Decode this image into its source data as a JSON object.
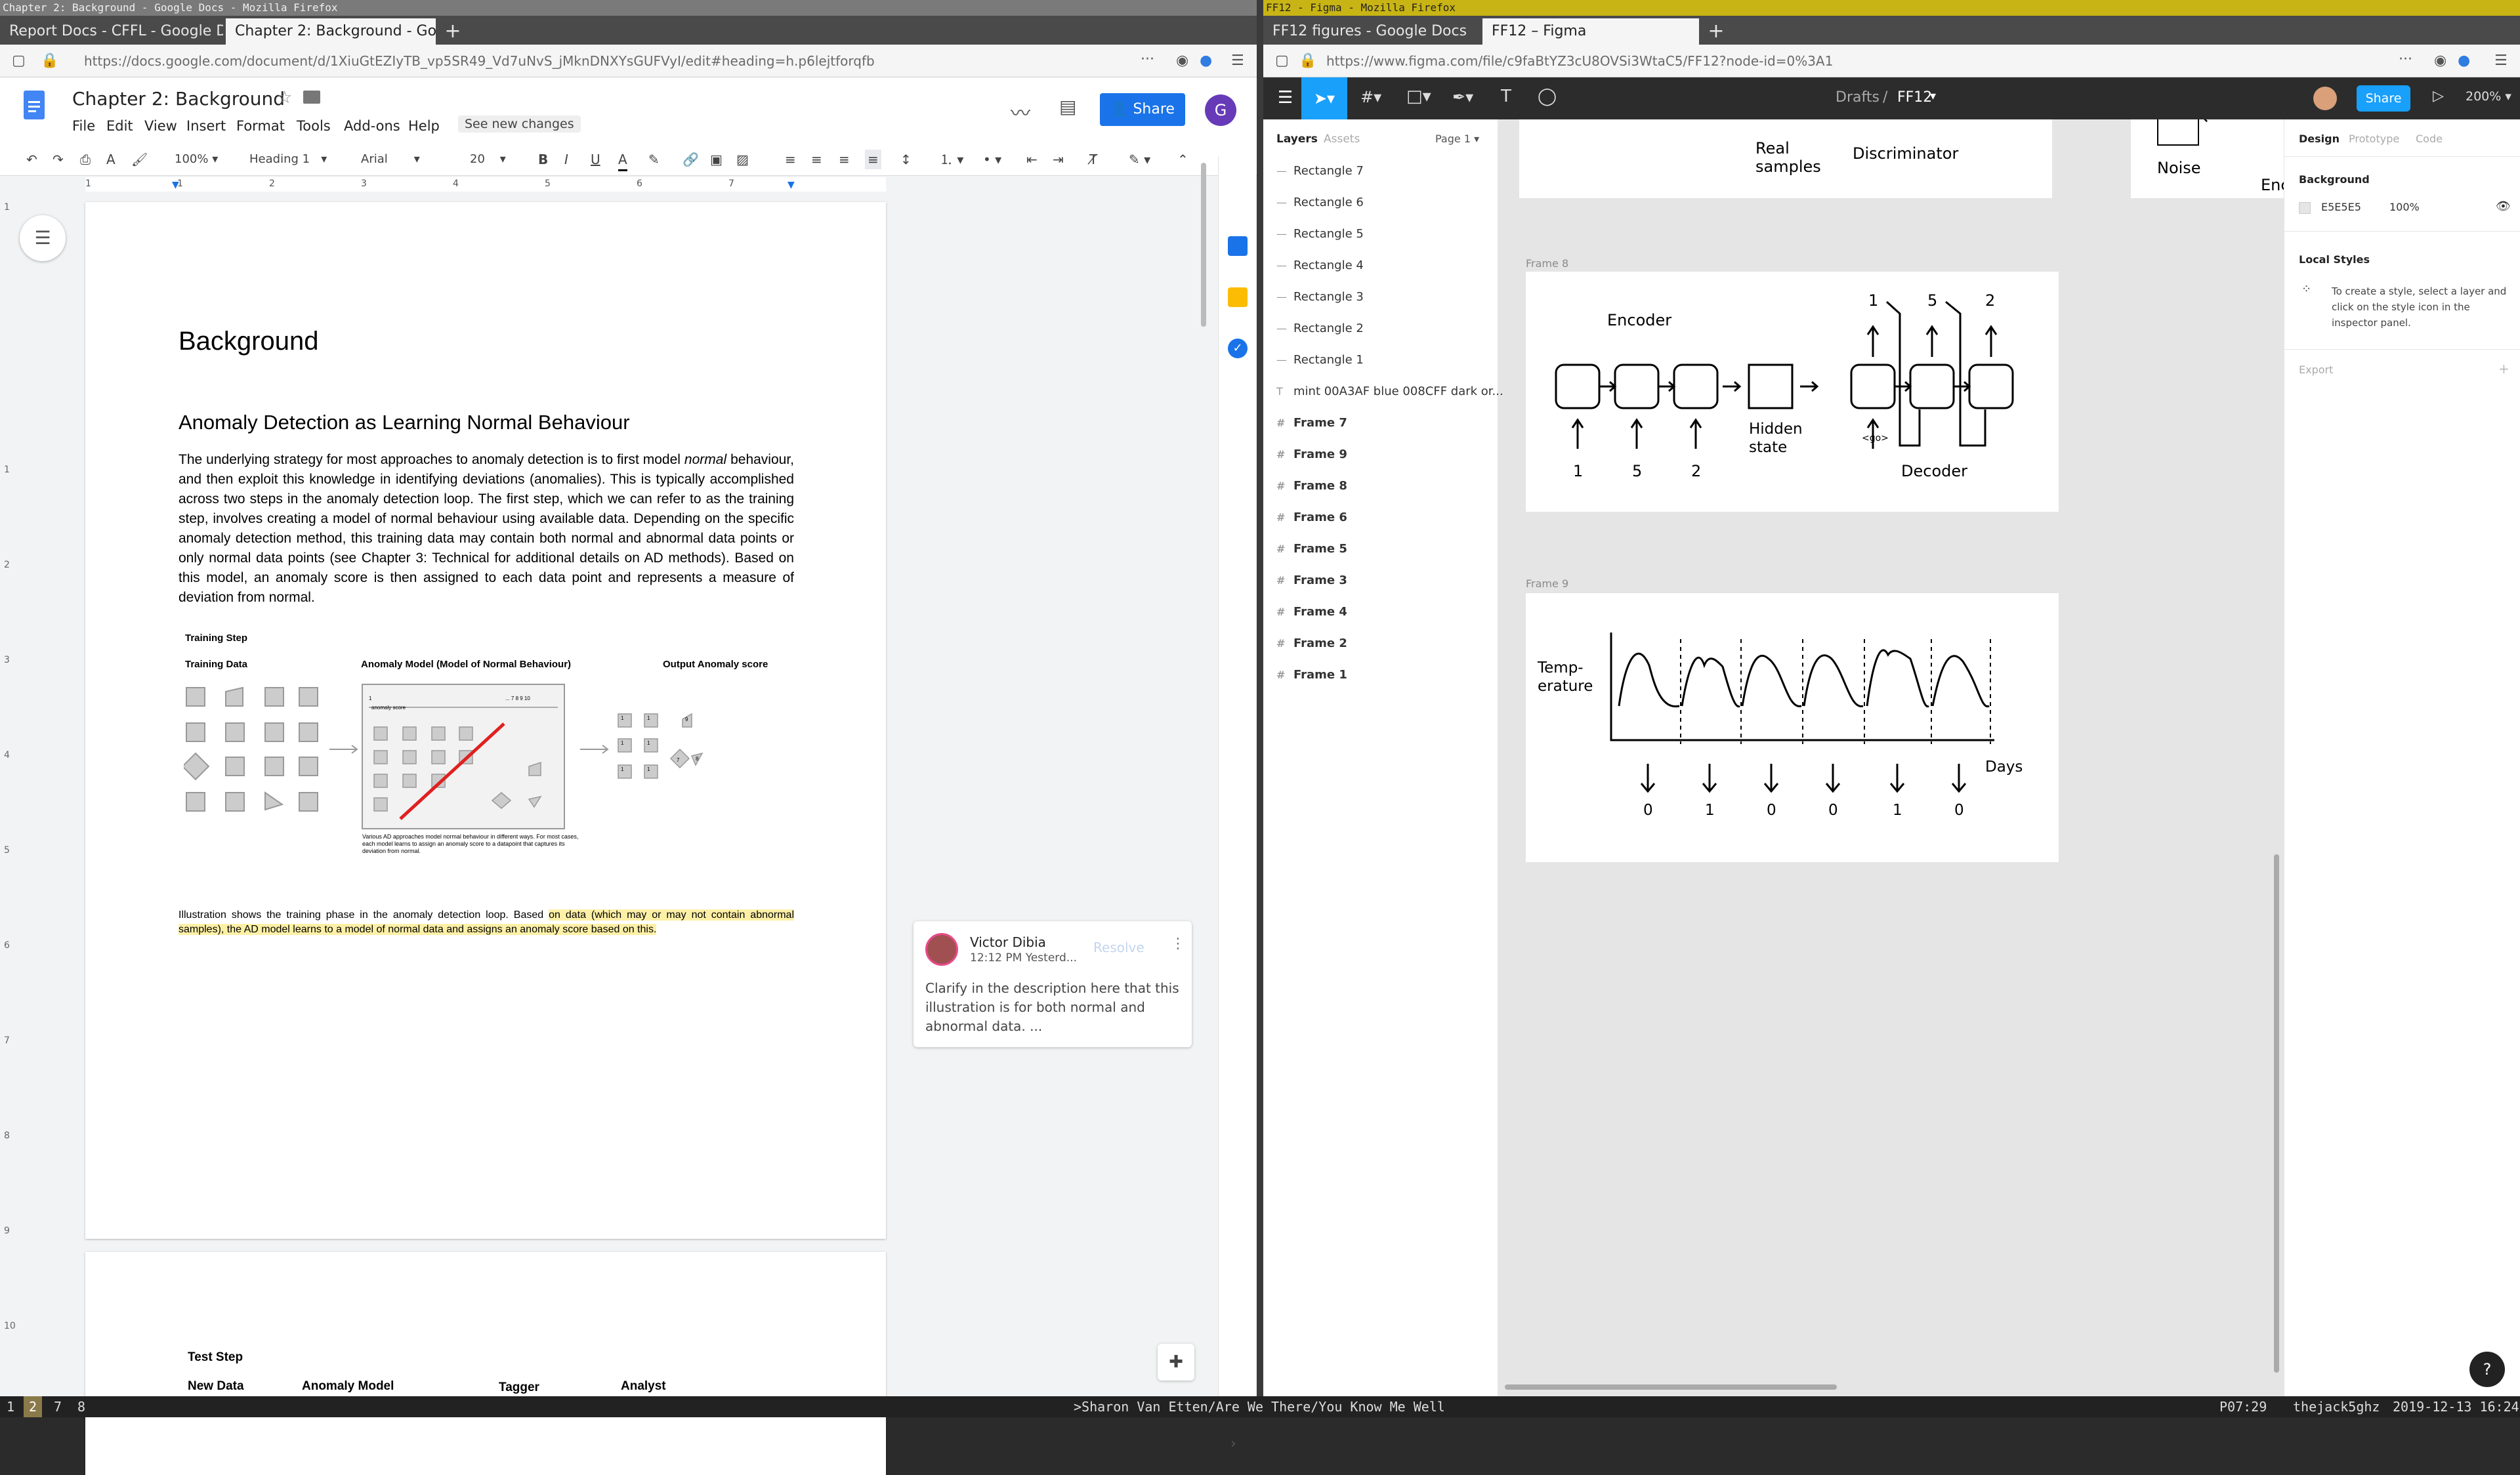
{
  "left_window": {
    "title": "Chapter 2: Background - Google Docs - Mozilla Firefox",
    "tabs": [
      {
        "label": "Report Docs - CFFL - Google D"
      },
      {
        "label": "Chapter 2: Background - Goog"
      }
    ],
    "url": "https://docs.google.com/document/d/1XiuGtEZIyTB_vp5SR49_Vd7uNvS_jMknDNXYsGUFVyI/edit#heading=h.p6lejtforqfb"
  },
  "docs": {
    "title": "Chapter 2: Background",
    "menu": [
      "File",
      "Edit",
      "View",
      "Insert",
      "Format",
      "Tools",
      "Add-ons",
      "Help"
    ],
    "see_changes": "See new changes",
    "share": "Share",
    "avatar": "G",
    "toolbar": {
      "zoom": "100%",
      "style": "Heading 1",
      "font": "Arial",
      "size": "20"
    },
    "ruler": [
      "1",
      "1",
      "2",
      "3",
      "4",
      "5",
      "6",
      "7"
    ],
    "margin_numbers": [
      "1",
      "1",
      "2",
      "3",
      "4",
      "5",
      "6",
      "7",
      "8",
      "9",
      "10"
    ],
    "heading": "Background",
    "subheading": "Anomaly Detection as Learning Normal Behaviour",
    "para_pre": "The underlying strategy for most approaches to anomaly detection is to first model ",
    "para_em": "normal",
    "para_post": " behaviour, and then exploit this knowledge in identifying deviations (anomalies).  This is typically accomplished across two steps in the anomaly detection loop. The first step, which we can refer to as the training step, involves creating a model of normal behaviour using available data. Depending on the specific anomaly detection method, this training data may contain both normal and abnormal data points or only normal data points (see Chapter 3: Technical for additional details on AD methods).  Based on this model, an anomaly score is then assigned  to each data point and represents  a measure of deviation from normal.",
    "fig": {
      "title": "Training Step",
      "col1": "Training Data",
      "col2": "Anomaly Model (Model of Normal Behaviour)",
      "col3": "Output Anomaly score",
      "score_label": "anomaly score",
      "score_ticks": "... 7  8  9  10",
      "score_start": "1",
      "caption": "Various AD approaches model normal behaviour in different ways. For most cases, each model learns to assign an anomaly score to a datapoint that captures its deviation from normal.",
      "scores": [
        "1",
        "1",
        "1",
        "1",
        "1",
        "1",
        "9",
        "7",
        "8"
      ]
    },
    "caption_pre": "Illustration shows the training phase in the anomaly detection loop. Based ",
    "caption_hl": "on data (which may or may not contain abnormal samples), the AD model learns to a model of normal data and assigns an anomaly score based on this.",
    "comment": {
      "author": "Victor Dibia",
      "time": "12:12 PM Yesterd...",
      "resolve": "Resolve",
      "text": "Clarify in the description here that this illustration is for both normal and abnormal data. ..."
    },
    "page2": {
      "title": "Test Step",
      "cols": [
        "New Data",
        "Anomaly Model",
        "Tagger",
        "Analyst"
      ]
    }
  },
  "right_window": {
    "title": "FF12 - Figma - Mozilla Firefox",
    "tabs": [
      {
        "label": "FF12 figures - Google Docs"
      },
      {
        "label": "FF12 – Figma"
      }
    ],
    "url": "https://www.figma.com/file/c9faBtYZ3cU8OVSi3WtaC5/FF12?node-id=0%3A1"
  },
  "figma": {
    "breadcrumb_drafts": "Drafts",
    "breadcrumb_sep": "/",
    "file": "FF12",
    "share": "Share",
    "zoom": "200%",
    "layer_tabs": [
      "Layers",
      "Assets"
    ],
    "page": "Page 1",
    "layers": [
      {
        "icon": "—",
        "label": "Rectangle 7"
      },
      {
        "icon": "—",
        "label": "Rectangle 6"
      },
      {
        "icon": "—",
        "label": "Rectangle 5"
      },
      {
        "icon": "—",
        "label": "Rectangle 4"
      },
      {
        "icon": "—",
        "label": "Rectangle 3"
      },
      {
        "icon": "—",
        "label": "Rectangle 2"
      },
      {
        "icon": "—",
        "label": "Rectangle 1"
      },
      {
        "icon": "T",
        "label": "mint 00A3AF blue 008CFF dark or..."
      },
      {
        "icon": "#",
        "label": "Frame 7"
      },
      {
        "icon": "#",
        "label": "Frame 9"
      },
      {
        "icon": "#",
        "label": "Frame 8"
      },
      {
        "icon": "#",
        "label": "Frame 6"
      },
      {
        "icon": "#",
        "label": "Frame 5"
      },
      {
        "icon": "#",
        "label": "Frame 3"
      },
      {
        "icon": "#",
        "label": "Frame 4"
      },
      {
        "icon": "#",
        "label": "Frame 2"
      },
      {
        "icon": "#",
        "label": "Frame 1"
      }
    ],
    "right_tabs": [
      "Design",
      "Prototype",
      "Code"
    ],
    "background_label": "Background",
    "bg_hex": "E5E5E5",
    "bg_opacity": "100%",
    "local_styles": "Local Styles",
    "local_styles_hint": "To create a style, select a layer and click on the style icon in the inspector panel.",
    "export": "Export",
    "top_frame": {
      "real": "Real\nsamples",
      "disc": "Discriminator",
      "noise": "Noise",
      "enc": "Enc"
    },
    "frame8": {
      "label": "Frame 8",
      "encoder": "Encoder",
      "decoder": "Decoder",
      "hidden": "Hidden\nstate",
      "go": "<go>",
      "inputs": [
        "1",
        "5",
        "2"
      ],
      "outputs": [
        "1",
        "5",
        "2"
      ]
    },
    "frame9": {
      "label": "Frame 9",
      "ylabel": "Temp-\nerature",
      "xlabel": "Days",
      "labels": [
        "0",
        "1",
        "0",
        "0",
        "1",
        "0"
      ]
    },
    "help": "?"
  },
  "statusbar": {
    "workspaces": [
      "1",
      "2",
      "7",
      "8"
    ],
    "now_playing": ">Sharon Van Etten/Are We There/You Know Me Well",
    "track_time": "P07:29",
    "host": "thejack5ghz",
    "datetime": "2019-12-13 16:24"
  }
}
